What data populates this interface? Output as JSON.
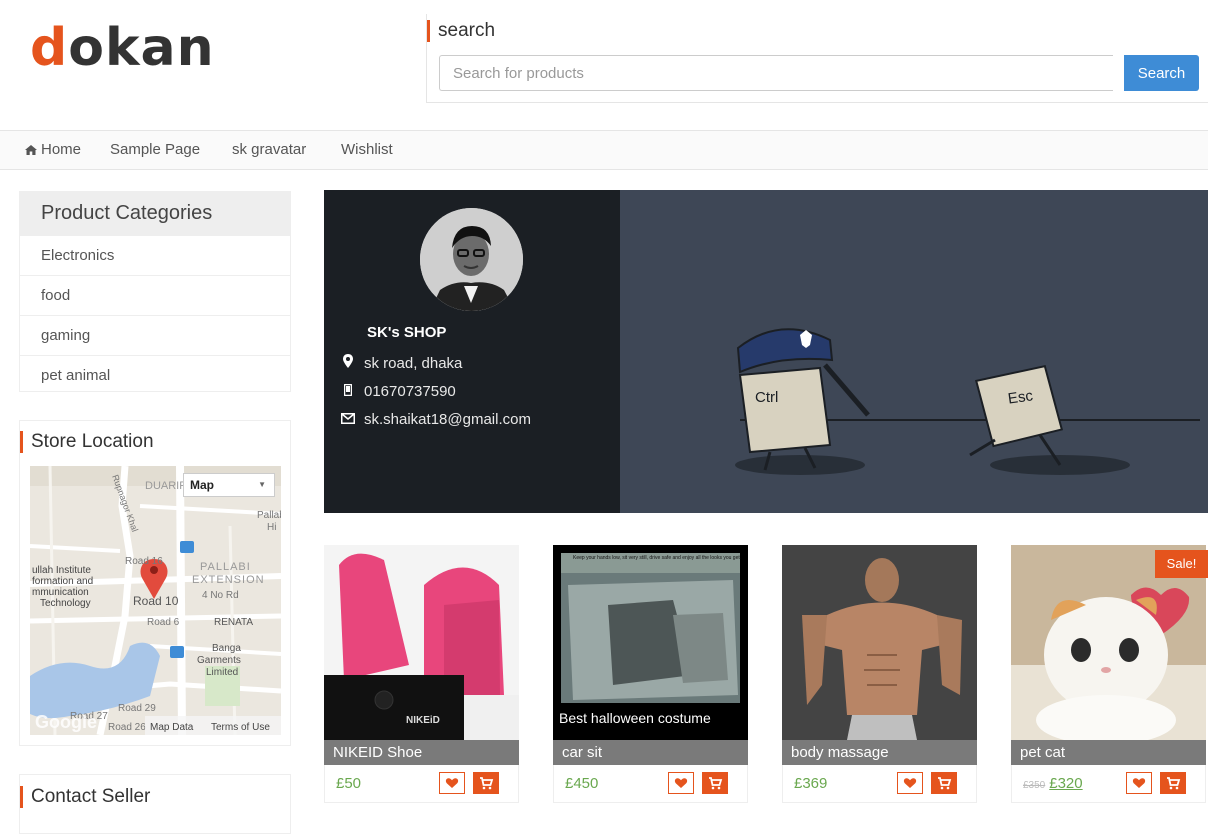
{
  "logo": {
    "first_letter": "d",
    "rest": "okan"
  },
  "search": {
    "title": "search",
    "placeholder": "Search for products",
    "button": "Search"
  },
  "nav": {
    "items": [
      "Home",
      "Sample Page",
      "sk gravatar",
      "Wishlist"
    ]
  },
  "sidebar": {
    "categories_title": "Product Categories",
    "categories": [
      "Electronics",
      "food",
      "gaming",
      "pet animal"
    ],
    "store_location_title": "Store Location",
    "contact_title": "Contact Seller",
    "map": {
      "type_label": "Map",
      "labels": [
        "DUARIP",
        "Pallab",
        "Hi",
        "Road 16",
        "Road 10",
        "PALLABI",
        "EXTENSION",
        "4 No Rd",
        "Road 6",
        "RENATA",
        "Banga",
        "Garments",
        "Limited",
        "Road 29",
        "Road 27",
        "Road 26",
        "ullah Institute",
        "formation and",
        "mmunication",
        "Technology",
        "Rupnagor Khal"
      ],
      "google": "Google",
      "map_data": "Map Data",
      "terms": "Terms of Use"
    }
  },
  "store": {
    "name": "SK's SHOP",
    "address": "sk road, dhaka",
    "phone": "01670737590",
    "email": "sk.shaikat18@gmail.com",
    "banner_keys": [
      "Ctrl",
      "Esc"
    ]
  },
  "products": [
    {
      "name": "NIKEID Shoe",
      "price": "£50",
      "image_text": "NIKEiD"
    },
    {
      "name": "car sit",
      "price": "£450",
      "image_text": "Best halloween costume",
      "image_caption_top": "Keep your hands low, sit very still, drive safe and enjoy all the looks you get."
    },
    {
      "name": "body massage",
      "price": "£369"
    },
    {
      "name": "pet cat",
      "price_old": "£350",
      "price": "£320",
      "badge": "Sale!"
    }
  ],
  "colors": {
    "accent": "#e5541d",
    "search_button": "#3e8cd6",
    "price": "#6aa84f",
    "banner": "#3e4756",
    "profile": "#1b1f24"
  }
}
